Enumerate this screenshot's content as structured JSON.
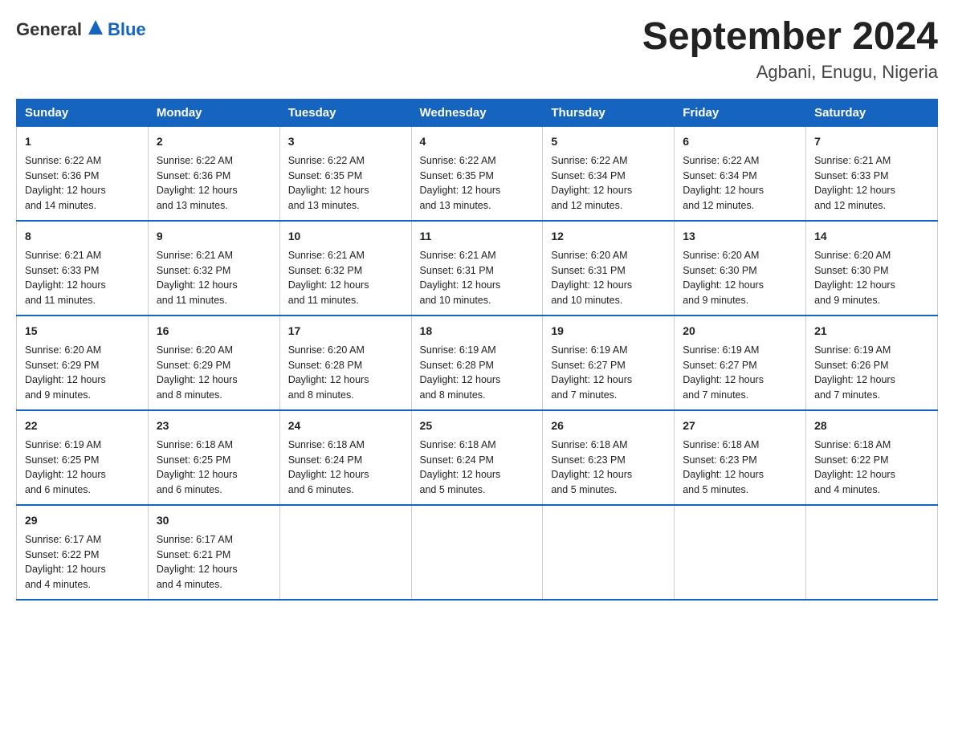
{
  "header": {
    "logo_general": "General",
    "logo_blue": "Blue",
    "month_title": "September 2024",
    "location": "Agbani, Enugu, Nigeria"
  },
  "days_of_week": [
    "Sunday",
    "Monday",
    "Tuesday",
    "Wednesday",
    "Thursday",
    "Friday",
    "Saturday"
  ],
  "weeks": [
    [
      {
        "day": "1",
        "sunrise": "6:22 AM",
        "sunset": "6:36 PM",
        "daylight": "12 hours and 14 minutes."
      },
      {
        "day": "2",
        "sunrise": "6:22 AM",
        "sunset": "6:36 PM",
        "daylight": "12 hours and 13 minutes."
      },
      {
        "day": "3",
        "sunrise": "6:22 AM",
        "sunset": "6:35 PM",
        "daylight": "12 hours and 13 minutes."
      },
      {
        "day": "4",
        "sunrise": "6:22 AM",
        "sunset": "6:35 PM",
        "daylight": "12 hours and 13 minutes."
      },
      {
        "day": "5",
        "sunrise": "6:22 AM",
        "sunset": "6:34 PM",
        "daylight": "12 hours and 12 minutes."
      },
      {
        "day": "6",
        "sunrise": "6:22 AM",
        "sunset": "6:34 PM",
        "daylight": "12 hours and 12 minutes."
      },
      {
        "day": "7",
        "sunrise": "6:21 AM",
        "sunset": "6:33 PM",
        "daylight": "12 hours and 12 minutes."
      }
    ],
    [
      {
        "day": "8",
        "sunrise": "6:21 AM",
        "sunset": "6:33 PM",
        "daylight": "12 hours and 11 minutes."
      },
      {
        "day": "9",
        "sunrise": "6:21 AM",
        "sunset": "6:32 PM",
        "daylight": "12 hours and 11 minutes."
      },
      {
        "day": "10",
        "sunrise": "6:21 AM",
        "sunset": "6:32 PM",
        "daylight": "12 hours and 11 minutes."
      },
      {
        "day": "11",
        "sunrise": "6:21 AM",
        "sunset": "6:31 PM",
        "daylight": "12 hours and 10 minutes."
      },
      {
        "day": "12",
        "sunrise": "6:20 AM",
        "sunset": "6:31 PM",
        "daylight": "12 hours and 10 minutes."
      },
      {
        "day": "13",
        "sunrise": "6:20 AM",
        "sunset": "6:30 PM",
        "daylight": "12 hours and 9 minutes."
      },
      {
        "day": "14",
        "sunrise": "6:20 AM",
        "sunset": "6:30 PM",
        "daylight": "12 hours and 9 minutes."
      }
    ],
    [
      {
        "day": "15",
        "sunrise": "6:20 AM",
        "sunset": "6:29 PM",
        "daylight": "12 hours and 9 minutes."
      },
      {
        "day": "16",
        "sunrise": "6:20 AM",
        "sunset": "6:29 PM",
        "daylight": "12 hours and 8 minutes."
      },
      {
        "day": "17",
        "sunrise": "6:20 AM",
        "sunset": "6:28 PM",
        "daylight": "12 hours and 8 minutes."
      },
      {
        "day": "18",
        "sunrise": "6:19 AM",
        "sunset": "6:28 PM",
        "daylight": "12 hours and 8 minutes."
      },
      {
        "day": "19",
        "sunrise": "6:19 AM",
        "sunset": "6:27 PM",
        "daylight": "12 hours and 7 minutes."
      },
      {
        "day": "20",
        "sunrise": "6:19 AM",
        "sunset": "6:27 PM",
        "daylight": "12 hours and 7 minutes."
      },
      {
        "day": "21",
        "sunrise": "6:19 AM",
        "sunset": "6:26 PM",
        "daylight": "12 hours and 7 minutes."
      }
    ],
    [
      {
        "day": "22",
        "sunrise": "6:19 AM",
        "sunset": "6:25 PM",
        "daylight": "12 hours and 6 minutes."
      },
      {
        "day": "23",
        "sunrise": "6:18 AM",
        "sunset": "6:25 PM",
        "daylight": "12 hours and 6 minutes."
      },
      {
        "day": "24",
        "sunrise": "6:18 AM",
        "sunset": "6:24 PM",
        "daylight": "12 hours and 6 minutes."
      },
      {
        "day": "25",
        "sunrise": "6:18 AM",
        "sunset": "6:24 PM",
        "daylight": "12 hours and 5 minutes."
      },
      {
        "day": "26",
        "sunrise": "6:18 AM",
        "sunset": "6:23 PM",
        "daylight": "12 hours and 5 minutes."
      },
      {
        "day": "27",
        "sunrise": "6:18 AM",
        "sunset": "6:23 PM",
        "daylight": "12 hours and 5 minutes."
      },
      {
        "day": "28",
        "sunrise": "6:18 AM",
        "sunset": "6:22 PM",
        "daylight": "12 hours and 4 minutes."
      }
    ],
    [
      {
        "day": "29",
        "sunrise": "6:17 AM",
        "sunset": "6:22 PM",
        "daylight": "12 hours and 4 minutes."
      },
      {
        "day": "30",
        "sunrise": "6:17 AM",
        "sunset": "6:21 PM",
        "daylight": "12 hours and 4 minutes."
      },
      null,
      null,
      null,
      null,
      null
    ]
  ]
}
